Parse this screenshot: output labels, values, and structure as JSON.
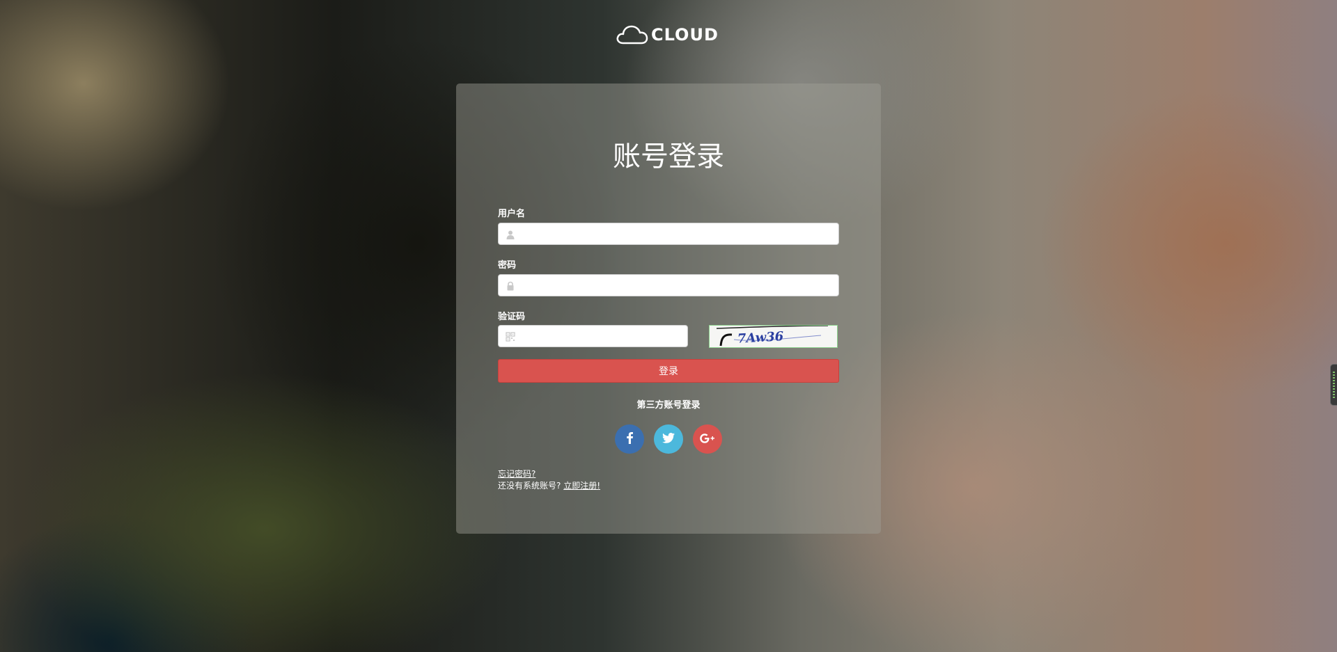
{
  "logo": {
    "text": "CLOUD",
    "icon": "cloud-icon"
  },
  "login": {
    "title": "账号登录",
    "username": {
      "label": "用户名",
      "value": "",
      "placeholder": "",
      "icon": "user-icon"
    },
    "password": {
      "label": "密码",
      "value": "",
      "placeholder": "",
      "icon": "lock-icon"
    },
    "captcha": {
      "label": "验证码",
      "value": "",
      "placeholder": "",
      "icon": "qrcode-icon",
      "image_text": "7Aw36"
    },
    "submit_label": "登录",
    "third_party_title": "第三方账号登录",
    "social": [
      {
        "name": "facebook",
        "icon": "facebook-icon",
        "color": "#3b6fb0"
      },
      {
        "name": "twitter",
        "icon": "twitter-icon",
        "color": "#4cb8dc"
      },
      {
        "name": "google-plus",
        "icon": "google-plus-icon",
        "color": "#d9534f"
      }
    ],
    "forgot_password": "忘记密码?",
    "no_account_text": "还没有系统账号?",
    "register_link": "立即注册!"
  },
  "colors": {
    "primary_button": "#d9534f",
    "panel_text": "#ffffff"
  }
}
